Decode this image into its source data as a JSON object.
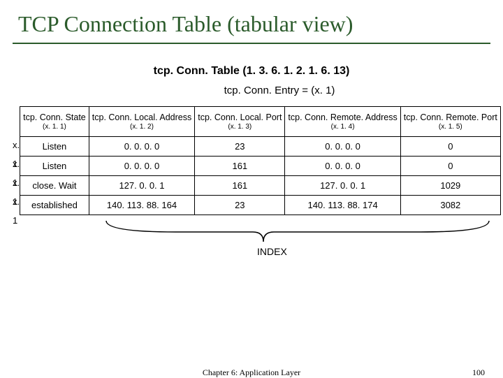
{
  "title": "TCP Connection Table (tabular view)",
  "table_oid_line": "tcp. Conn. Table (1. 3. 6. 1. 2. 1. 6. 13)",
  "entry_oid_line": "tcp. Conn. Entry = (x. 1)",
  "columns": [
    {
      "name": "tcp. Conn. State",
      "oid": "(x. 1. 1)"
    },
    {
      "name": "tcp. Conn. Local. Address",
      "oid": "(x. 1. 2)"
    },
    {
      "name": "tcp. Conn. Local. Port",
      "oid": "(x. 1. 3)"
    },
    {
      "name": "tcp. Conn. Remote. Address",
      "oid": "(x. 1. 4)"
    },
    {
      "name": "tcp. Conn. Remote. Port",
      "oid": "(x. 1. 5)"
    }
  ],
  "row_labels": [
    "x. 1",
    "x. 1",
    "x. 1",
    "x. 1"
  ],
  "rows": [
    {
      "state": "Listen",
      "laddr": "0. 0. 0. 0",
      "lport": "23",
      "raddr": "0. 0. 0. 0",
      "rport": "0"
    },
    {
      "state": "Listen",
      "laddr": "0. 0. 0. 0",
      "lport": "161",
      "raddr": "0. 0. 0. 0",
      "rport": "0"
    },
    {
      "state": "close. Wait",
      "laddr": "127. 0. 0. 1",
      "lport": "161",
      "raddr": "127. 0. 0. 1",
      "rport": "1029"
    },
    {
      "state": "established",
      "laddr": "140. 113. 88. 164",
      "lport": "23",
      "raddr": "140. 113. 88. 174",
      "rport": "3082"
    }
  ],
  "index_label": "INDEX",
  "chapter": "Chapter 6: Application Layer",
  "page_number": "100"
}
